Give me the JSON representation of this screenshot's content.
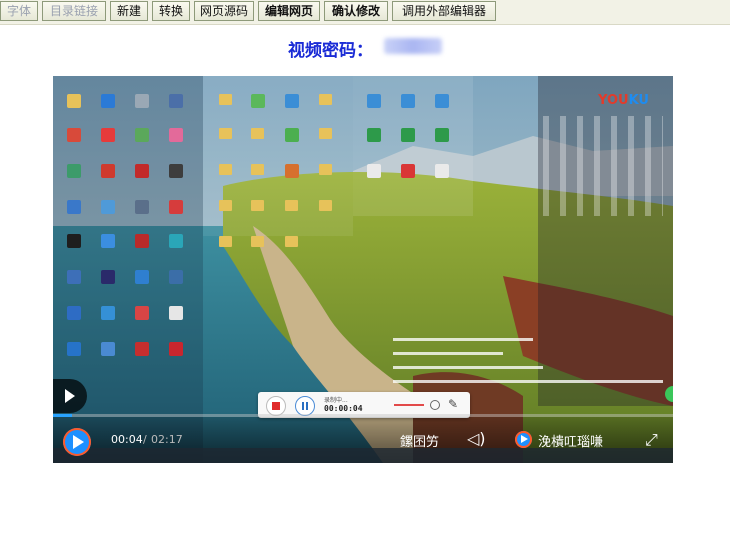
{
  "toolbar": {
    "buttons": [
      {
        "label": "字体",
        "style": "dim"
      },
      {
        "label": "目录链接",
        "style": "dim"
      },
      {
        "label": "新建",
        "style": "normal"
      },
      {
        "label": "转换",
        "style": "normal"
      },
      {
        "label": "网页源码",
        "style": "normal"
      },
      {
        "label": "编辑网页",
        "style": "bold"
      },
      {
        "label": "确认修改",
        "style": "bold"
      },
      {
        "label": "调用外部编辑器",
        "style": "normal"
      }
    ]
  },
  "page": {
    "title": "视频密码："
  },
  "player": {
    "current_time": "00:04",
    "separator": "/",
    "total_time": "02:17",
    "progress": 0.03,
    "ctrl_text_left": "鏍囨竻",
    "ctrl_text_right": "浼樻叿瑙嗛",
    "watermark_you": "YOU",
    "watermark_ku": "KU"
  },
  "recorder": {
    "status": "录制中...",
    "time": "00:00:04"
  },
  "colors": {
    "title": "#1a2bd6",
    "accent_blue": "#1e90ff",
    "accent_red": "#e02b2b",
    "toolbar_bg": "#f2f2e6"
  },
  "icons": {
    "stop": "stop-icon",
    "pause": "pause-icon",
    "pen": "pen-icon",
    "volume": "volume-icon",
    "fullscreen": "fullscreen-icon",
    "play": "play-icon"
  }
}
